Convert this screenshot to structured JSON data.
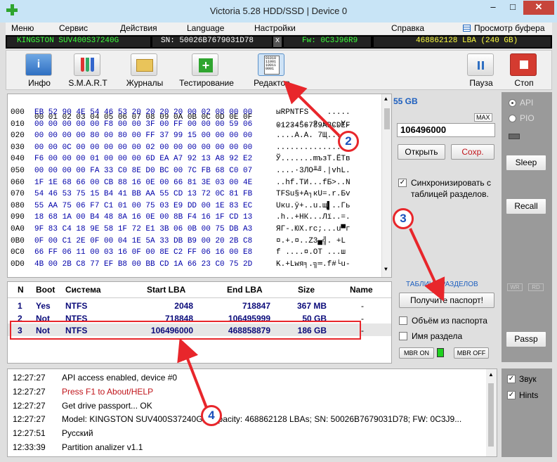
{
  "window": {
    "title": "Victoria 5.28 HDD/SSD | Device 0",
    "min": "–",
    "max": "□",
    "close": "✕"
  },
  "menu": {
    "items": [
      "Меню",
      "Сервис",
      "Действия",
      "Language",
      "Настройки",
      "Справка"
    ],
    "buffer_view": "Просмотр буфера"
  },
  "infobar": {
    "model": "KINGSTON SUV400S37240G",
    "serial": "SN: 50026B7679031D78",
    "close": "x",
    "firmware": "Fw: 0C3J96R9",
    "capacity": "468862128 LBA (240 GB)"
  },
  "toolbar": {
    "info": "Инфо",
    "smart": "S.M.A.R.T",
    "logs": "Журналы",
    "testing": "Тестирование",
    "editor": "Редактор",
    "pause": "Пауза",
    "stop": "Стоп",
    "editor_icon_text": "01010\n11001\n10011\n0001"
  },
  "hex": {
    "header_offset": "",
    "header_bytes": "00 01 02 03 04 05 06 07 08 09 0A 0B 0C 0D 0E 0F",
    "header_ascii": "0123456789ABCDEF",
    "rows": [
      {
        "off": "000",
        "bytes": "EB 52 90 4E 54 46 53 20 20 20 20 00 02 08 00 00",
        "ascii": "ыRPNTFS    ....."
      },
      {
        "off": "010",
        "bytes": "00 00 00 00 00 F8 00 00 3F 00 FF 00 00 00 59 06",
        "ascii": ".....°..?.я...Y."
      },
      {
        "off": "020",
        "bytes": "00 00 00 00 80 00 80 00 FF 37 99 15 00 00 00 00",
        "ascii": "....А.А. 7Щ....."
      },
      {
        "off": "030",
        "bytes": "00 00 0C 00 00 00 00 00 02 00 00 00 00 00 00 00",
        "ascii": "................"
      },
      {
        "off": "040",
        "bytes": "F6 00 00 00 01 00 00 00 6D EA A7 92 13 A8 92 E2",
        "ascii": "Ў.......mъзТ.ЁТв"
      },
      {
        "off": "050",
        "bytes": "00 00 00 00 FA 33 C0 8E D0 BC 00 7C FB 68 C0 07",
        "ascii": "....·3ЛО╨╝.|vhL."
      },
      {
        "off": "060",
        "bytes": "1F 1E 68 66 00 CB 88 16 0E 00 66 81 3E 03 00 4E",
        "ascii": "..hf.ТИ...fБ>..N"
      },
      {
        "off": "070",
        "bytes": "54 46 53 75 15 B4 41 BB AA 55 CD 13 72 0C 81 FB",
        "ascii": "TFSu§+A┐кU=.r.Бv"
      },
      {
        "off": "080",
        "bytes": "55 AA 75 06 F7 C1 01 00 75 03 E9 DD 00 1E 83 EC",
        "ascii": "Uкu.ў+..u.щ▌..Гь"
      },
      {
        "off": "090",
        "bytes": "18 68 1A 00 B4 48 8A 16 0E 00 8B F4 16 1F CD 13",
        "ascii": ".h..+HК...Лї..=."
      },
      {
        "off": "0A0",
        "bytes": "9F 83 C4 18 9E 58 1F 72 E1 3B 06 0B 00 75 DB A3",
        "ascii": "ЯГ-.ЮX.rс;...u▀г"
      },
      {
        "off": "0B0",
        "bytes": "0F 00 C1 2E 0F 00 04 1E 5A 33 DB B9 00 20 2B C8",
        "ascii": "¤.+.¤..Z3▄╣. +L"
      },
      {
        "off": "0C0",
        "bytes": "66 FF 06 11 00 03 16 0F 00 8E C2 FF 06 16 00 E8",
        "ascii": "f ....¤.ОТ ...ш"
      },
      {
        "off": "0D0",
        "bytes": "4B 00 2B C8 77 EF B8 00 BB CD 1A 66 23 C0 75 2D",
        "ascii": "K.+Lwя╕.╗═.f#└u-"
      }
    ]
  },
  "right": {
    "size": "55 GB",
    "max": "MAX",
    "lba_value": "106496000",
    "open": "Открыть",
    "save": "Сохр.",
    "sync_checked": "✓",
    "sync_label": "Синхронизировать с таблицей разделов."
  },
  "partitions": {
    "headers": [
      "N",
      "Boot",
      "Система",
      "Start LBA",
      "End LBA",
      "Size",
      "Name"
    ],
    "rows": [
      {
        "n": "1",
        "boot": "Yes",
        "fs": "NTFS",
        "start": "2048",
        "end": "718847",
        "size": "367 MB",
        "name": "-"
      },
      {
        "n": "2",
        "boot": "Not",
        "fs": "NTFS",
        "start": "718848",
        "end": "106495999",
        "size": "50 GB",
        "name": "-"
      },
      {
        "n": "3",
        "boot": "Not",
        "fs": "NTFS",
        "start": "106496000",
        "end": "468858879",
        "size": "186 GB",
        "name": "-"
      }
    ],
    "panel_title": "ТАБЛИЦА РАЗДЕЛОВ",
    "get_passport": "Получите паспорт!",
    "vol_from_passport": "Объём из паспорта",
    "part_name": "Имя раздела",
    "mbr_on": "MBR ON",
    "mbr_off": "MBR OFF"
  },
  "side": {
    "api": "API",
    "pio": "PIO",
    "sleep": "Sleep",
    "recall": "Recall",
    "wr": "WR",
    "rd": "RD",
    "passp": "Passp"
  },
  "log": [
    {
      "t": "12:27:27",
      "m": "API access enabled, device #0",
      "c": "#000"
    },
    {
      "t": "12:27:27",
      "m": "Press F1 to About/HELP",
      "c": "#c0141a"
    },
    {
      "t": "12:27:27",
      "m": "Get drive passport... OK",
      "c": "#000"
    },
    {
      "t": "12:27:27",
      "m": "Model: KINGSTON SUV400S37240G; Capacity: 468862128 LBAs; SN: 50026B7679031D78; FW: 0C3J9...",
      "c": "#000"
    },
    {
      "t": "12:27:51",
      "m": "Русский",
      "c": "#000"
    },
    {
      "t": "12:33:39",
      "m": "Partition analizer v1.1",
      "c": "#000"
    }
  ],
  "opts": {
    "sound": "Звук",
    "hints": "Hints",
    "check": "✓"
  },
  "callouts": [
    "2",
    "3",
    "4"
  ],
  "colors": {
    "accent_red": "#e8262b",
    "hex_blue": "#0000aa",
    "model_green": "#3cff3c",
    "size_yellow": "#ffff40"
  }
}
